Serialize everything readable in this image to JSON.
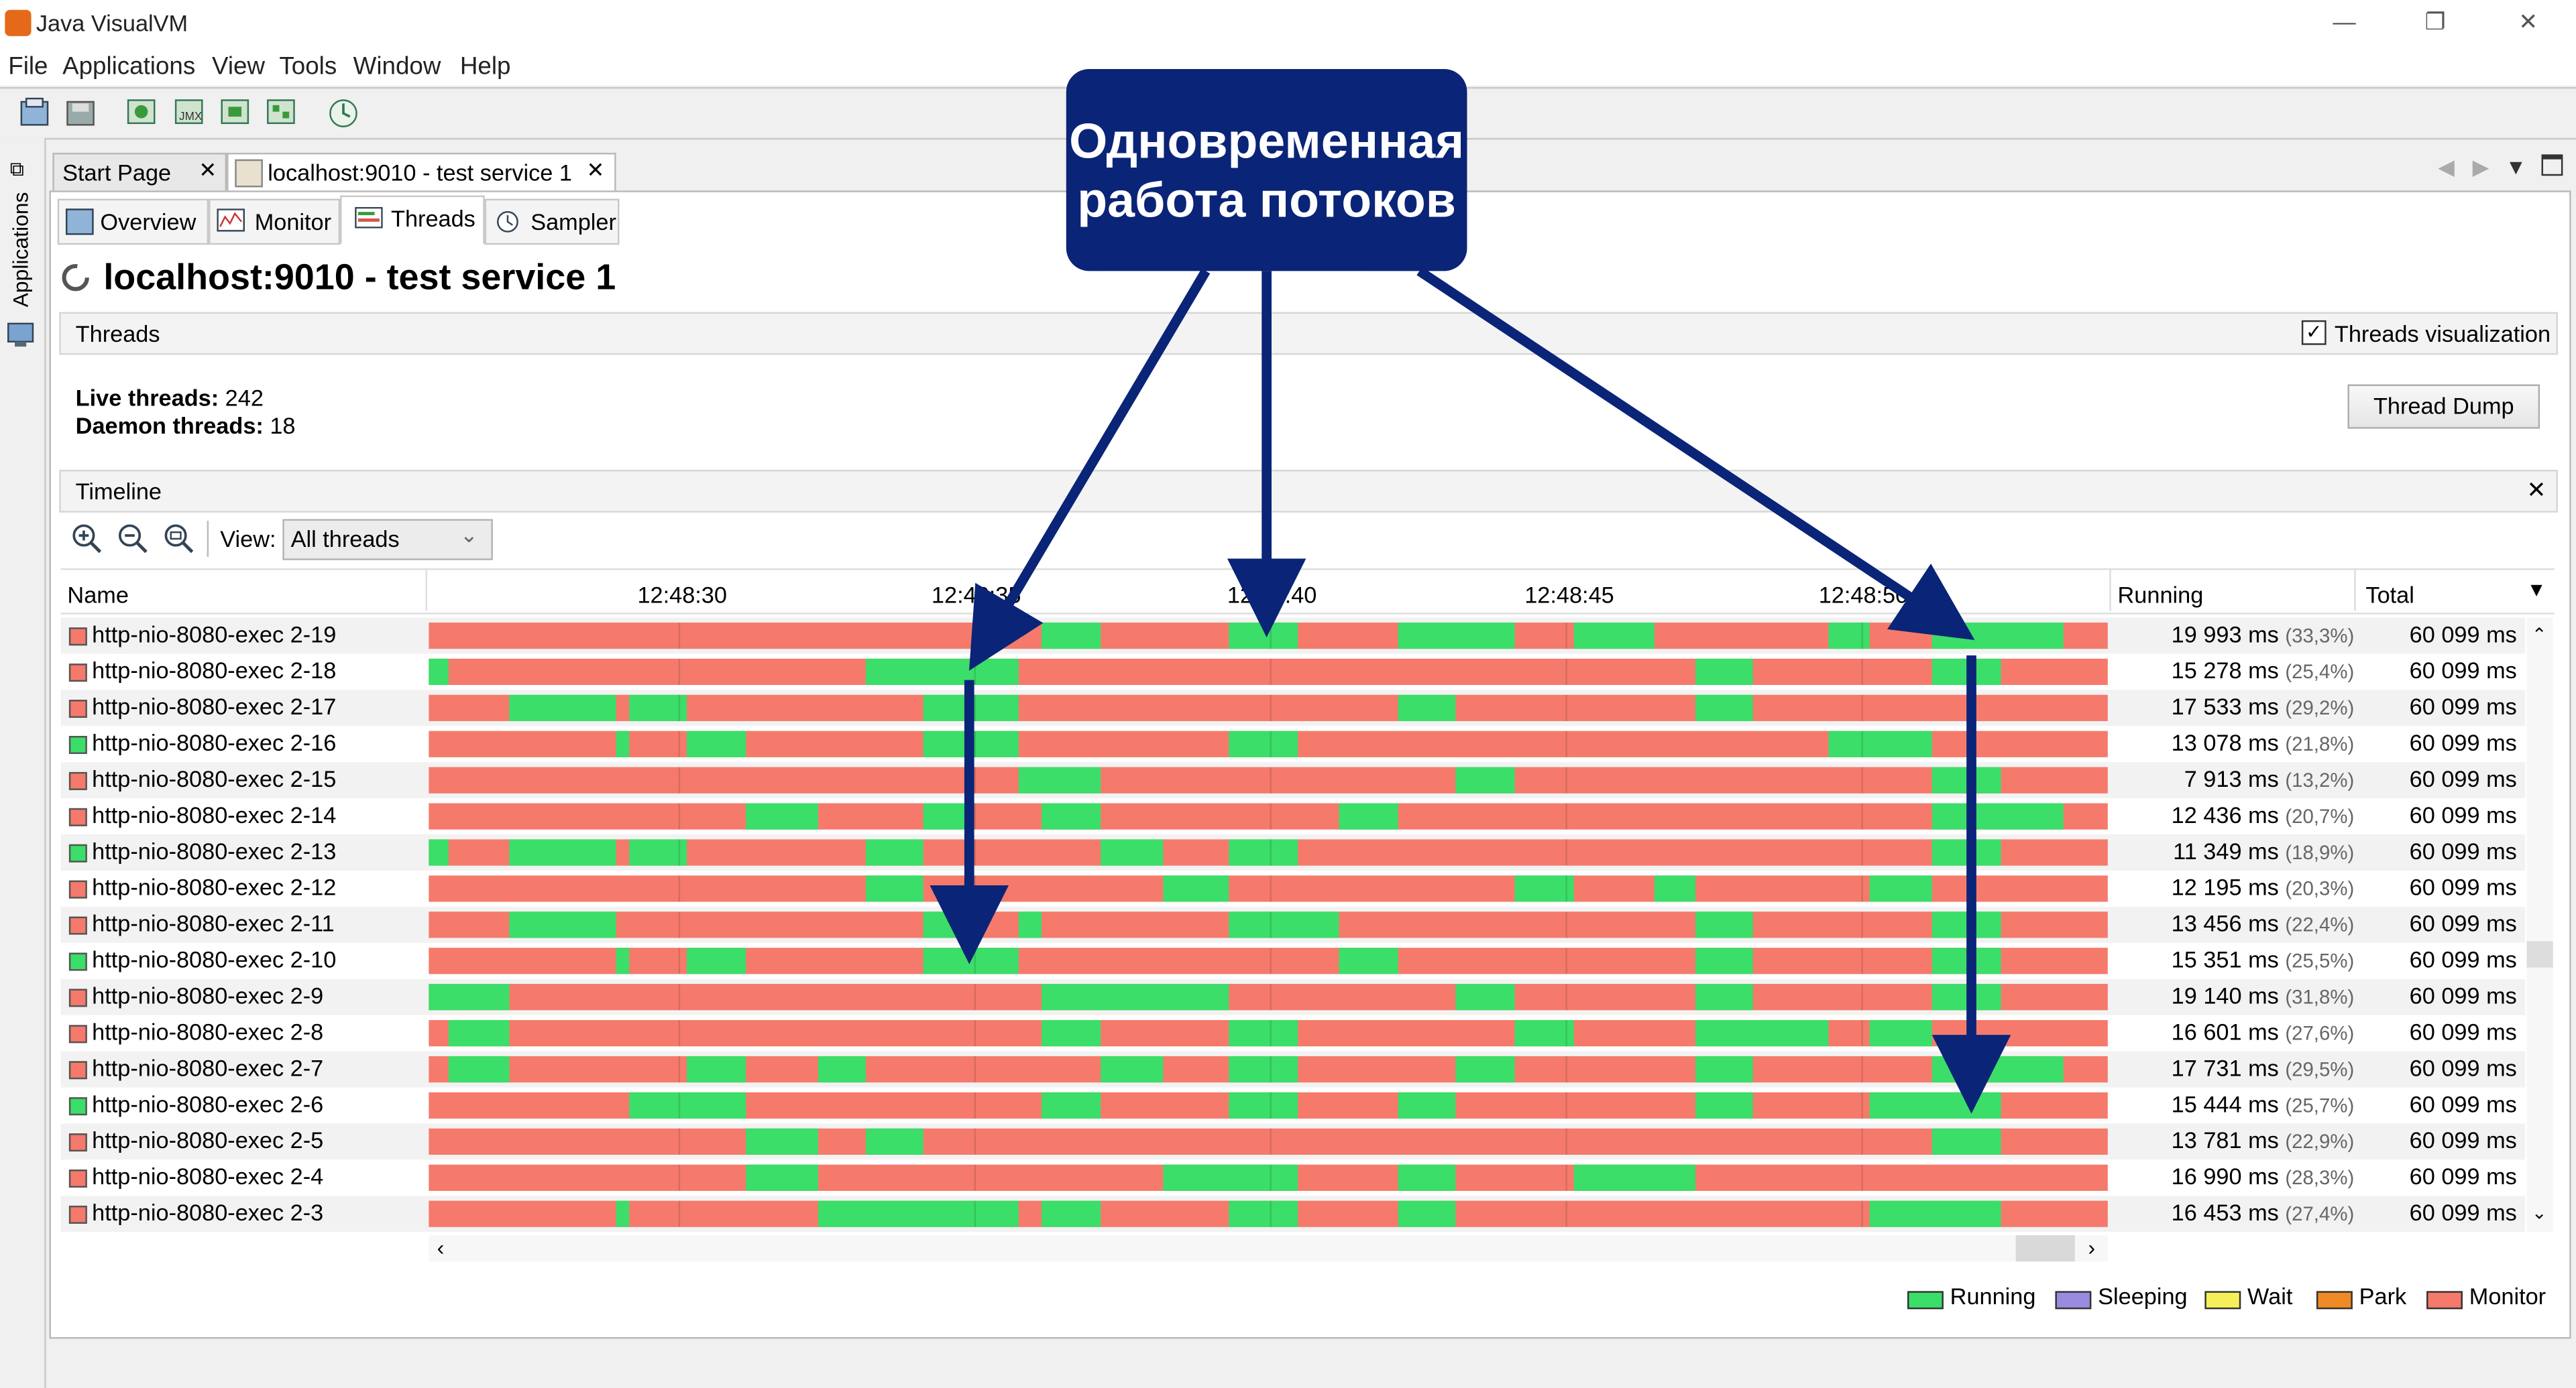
{
  "window": {
    "title": "Java VisualVM"
  },
  "menu": [
    "File",
    "Applications",
    "View",
    "Tools",
    "Window",
    "Help"
  ],
  "side_panel": {
    "label": "Applications"
  },
  "doc_tabs": [
    {
      "label": "Start Page",
      "active": false
    },
    {
      "label": "localhost:9010 - test service 1",
      "active": true
    }
  ],
  "sub_tabs": [
    {
      "label": "Overview",
      "active": false
    },
    {
      "label": "Monitor",
      "active": false
    },
    {
      "label": "Threads",
      "active": true
    },
    {
      "label": "Sampler",
      "active": false
    }
  ],
  "page_title": "localhost:9010 - test service 1",
  "threads_panel": {
    "header": "Threads",
    "visualization_checkbox": {
      "label": "Threads visualization",
      "checked": true
    },
    "live_label": "Live threads:",
    "live_value": "242",
    "daemon_label": "Daemon threads:",
    "daemon_value": "18",
    "dump_button": "Thread Dump"
  },
  "timeline": {
    "header": "Timeline",
    "view_label": "View:",
    "view_selected": "All threads",
    "columns": {
      "name": "Name",
      "running": "Running",
      "total": "Total"
    },
    "time_ticks": [
      "12:48:30",
      "12:48:35",
      "12:48:40",
      "12:48:45",
      "12:48:50"
    ],
    "colors": {
      "running": "#3bde68",
      "monitor": "#f57a6c",
      "sleeping": "#9a8ae0",
      "wait": "#f7ef5a",
      "park": "#f08a24"
    },
    "rows": [
      {
        "name": "http-nio-8080-exec 2-19",
        "state": "monitor",
        "running": "19 993 ms",
        "pct": "(33,3%)",
        "total": "60 099 ms",
        "green": [
          [
            634,
            670
          ],
          [
            748,
            790
          ],
          [
            851,
            922
          ],
          [
            958,
            1007
          ],
          [
            1113,
            1138
          ],
          [
            1176,
            1256
          ]
        ]
      },
      {
        "name": "http-nio-8080-exec 2-18",
        "state": "monitor",
        "running": "15 278 ms",
        "pct": "(25,4%)",
        "total": "60 099 ms",
        "green": [
          [
            261,
            273
          ],
          [
            527,
            620
          ],
          [
            1032,
            1067
          ],
          [
            1176,
            1218
          ]
        ]
      },
      {
        "name": "http-nio-8080-exec 2-17",
        "state": "monitor",
        "running": "17 533 ms",
        "pct": "(29,2%)",
        "total": "60 099 ms",
        "green": [
          [
            310,
            375
          ],
          [
            383,
            418
          ],
          [
            562,
            620
          ],
          [
            851,
            886
          ],
          [
            1032,
            1067
          ]
        ]
      },
      {
        "name": "http-nio-8080-exec 2-16",
        "state": "running",
        "running": "13 078 ms",
        "pct": "(21,8%)",
        "total": "60 099 ms",
        "green": [
          [
            375,
            383
          ],
          [
            418,
            454
          ],
          [
            562,
            620
          ],
          [
            748,
            790
          ],
          [
            1113,
            1176
          ]
        ]
      },
      {
        "name": "http-nio-8080-exec 2-15",
        "state": "monitor",
        "running": "7 913 ms",
        "pct": "(13,2%)",
        "total": "60 099 ms",
        "green": [
          [
            620,
            670
          ],
          [
            886,
            922
          ],
          [
            1176,
            1218
          ]
        ]
      },
      {
        "name": "http-nio-8080-exec 2-14",
        "state": "monitor",
        "running": "12 436 ms",
        "pct": "(20,7%)",
        "total": "60 099 ms",
        "green": [
          [
            454,
            498
          ],
          [
            562,
            593
          ],
          [
            634,
            670
          ],
          [
            815,
            851
          ],
          [
            1176,
            1256
          ]
        ]
      },
      {
        "name": "http-nio-8080-exec 2-13",
        "state": "running",
        "running": "11 349 ms",
        "pct": "(18,9%)",
        "total": "60 099 ms",
        "green": [
          [
            261,
            273
          ],
          [
            310,
            375
          ],
          [
            383,
            418
          ],
          [
            527,
            562
          ],
          [
            670,
            708
          ],
          [
            748,
            790
          ],
          [
            1176,
            1218
          ]
        ]
      },
      {
        "name": "http-nio-8080-exec 2-12",
        "state": "monitor",
        "running": "12 195 ms",
        "pct": "(20,3%)",
        "total": "60 099 ms",
        "green": [
          [
            527,
            562
          ],
          [
            708,
            748
          ],
          [
            922,
            958
          ],
          [
            1007,
            1032
          ],
          [
            1138,
            1176
          ]
        ]
      },
      {
        "name": "http-nio-8080-exec 2-11",
        "state": "monitor",
        "running": "13 456 ms",
        "pct": "(22,4%)",
        "total": "60 099 ms",
        "green": [
          [
            310,
            375
          ],
          [
            562,
            593
          ],
          [
            620,
            634
          ],
          [
            748,
            815
          ],
          [
            1032,
            1067
          ],
          [
            1176,
            1218
          ]
        ]
      },
      {
        "name": "http-nio-8080-exec 2-10",
        "state": "running",
        "running": "15 351 ms",
        "pct": "(25,5%)",
        "total": "60 099 ms",
        "green": [
          [
            375,
            383
          ],
          [
            418,
            454
          ],
          [
            562,
            620
          ],
          [
            815,
            851
          ],
          [
            1032,
            1067
          ],
          [
            1176,
            1218
          ]
        ]
      },
      {
        "name": "http-nio-8080-exec 2-9",
        "state": "monitor",
        "running": "19 140 ms",
        "pct": "(31,8%)",
        "total": "60 099 ms",
        "green": [
          [
            261,
            310
          ],
          [
            634,
            748
          ],
          [
            886,
            922
          ],
          [
            1032,
            1067
          ],
          [
            1176,
            1218
          ]
        ]
      },
      {
        "name": "http-nio-8080-exec 2-8",
        "state": "monitor",
        "running": "16 601 ms",
        "pct": "(27,6%)",
        "total": "60 099 ms",
        "green": [
          [
            273,
            310
          ],
          [
            634,
            670
          ],
          [
            748,
            790
          ],
          [
            922,
            958
          ],
          [
            1032,
            1113
          ],
          [
            1138,
            1176
          ]
        ]
      },
      {
        "name": "http-nio-8080-exec 2-7",
        "state": "monitor",
        "running": "17 731 ms",
        "pct": "(29,5%)",
        "total": "60 099 ms",
        "green": [
          [
            273,
            310
          ],
          [
            418,
            454
          ],
          [
            498,
            527
          ],
          [
            670,
            708
          ],
          [
            748,
            790
          ],
          [
            886,
            922
          ],
          [
            1032,
            1067
          ],
          [
            1176,
            1256
          ]
        ]
      },
      {
        "name": "http-nio-8080-exec 2-6",
        "state": "running",
        "running": "15 444 ms",
        "pct": "(25,7%)",
        "total": "60 099 ms",
        "green": [
          [
            383,
            454
          ],
          [
            634,
            670
          ],
          [
            748,
            790
          ],
          [
            851,
            886
          ],
          [
            1032,
            1067
          ],
          [
            1138,
            1218
          ]
        ]
      },
      {
        "name": "http-nio-8080-exec 2-5",
        "state": "monitor",
        "running": "13 781 ms",
        "pct": "(22,9%)",
        "total": "60 099 ms",
        "green": [
          [
            454,
            498
          ],
          [
            527,
            562
          ],
          [
            1176,
            1218
          ]
        ]
      },
      {
        "name": "http-nio-8080-exec 2-4",
        "state": "monitor",
        "running": "16 990 ms",
        "pct": "(28,3%)",
        "total": "60 099 ms",
        "green": [
          [
            454,
            498
          ],
          [
            708,
            790
          ],
          [
            851,
            886
          ],
          [
            958,
            1032
          ]
        ]
      },
      {
        "name": "http-nio-8080-exec 2-3",
        "state": "monitor",
        "running": "16 453 ms",
        "pct": "(27,4%)",
        "total": "60 099 ms",
        "green": [
          [
            375,
            383
          ],
          [
            498,
            620
          ],
          [
            634,
            670
          ],
          [
            748,
            790
          ],
          [
            851,
            886
          ],
          [
            1138,
            1218
          ]
        ]
      }
    ]
  },
  "legend": [
    "Running",
    "Sleeping",
    "Wait",
    "Park",
    "Monitor"
  ],
  "annotation": {
    "line1": "Одновременная",
    "line2": "работа потоков"
  }
}
